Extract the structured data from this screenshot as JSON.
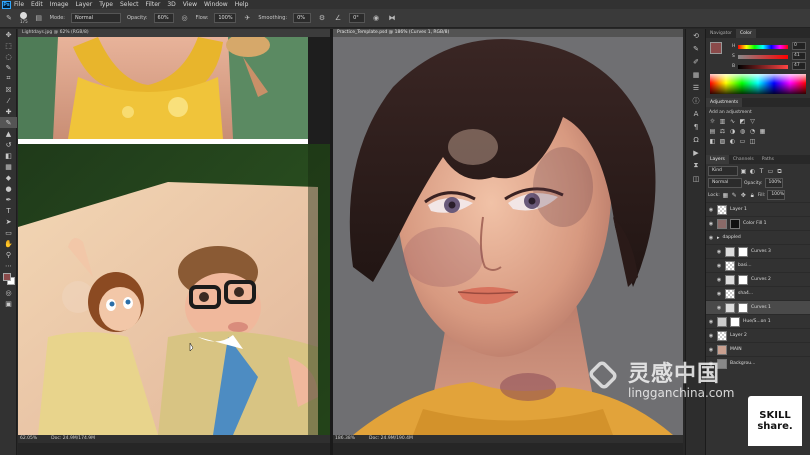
{
  "app": {
    "logo": "Ps"
  },
  "menu": [
    "File",
    "Edit",
    "Image",
    "Layer",
    "Type",
    "Select",
    "Filter",
    "3D",
    "View",
    "Window",
    "Help"
  ],
  "options": {
    "brush_size": "175",
    "mode_label": "Mode:",
    "mode_value": "Normal",
    "opacity_label": "Opacity:",
    "opacity_value": "60%",
    "flow_label": "Flow:",
    "flow_value": "100%",
    "smoothing_label": "Smoothing:",
    "smoothing_value": "0%",
    "angle_value": "0°"
  },
  "doc1": {
    "tab_title": "Lightdays.jpg @ 62% (RGB/8)",
    "zoom": "62.05%",
    "info": "Doc: 24.9M/174.9M"
  },
  "doc2": {
    "tab_title": "Practice_Template.psd @ 186% (Curves 1, RGB/8)",
    "zoom": "186.38%",
    "info": "Doc: 24.9M/190.4M"
  },
  "color_panel": {
    "tabs": [
      "Navigator",
      "Color"
    ],
    "active_tab": "Color",
    "h": "H",
    "s": "S",
    "b": "B",
    "h_value": "0",
    "s_value": "41",
    "b_value": "47",
    "foreground": "#8a4a4a"
  },
  "adjustments": {
    "title": "Adjustments",
    "hint": "Add an adjustment"
  },
  "layers": {
    "tabs": [
      "Layers",
      "Channels",
      "Paths"
    ],
    "active_tab": "Layers",
    "kind": "Kind",
    "blend": "Normal",
    "opacity_label": "Opacity:",
    "opacity": "100%",
    "lock_label": "Lock:",
    "fill_label": "Fill:",
    "fill": "100%",
    "items": [
      {
        "name": "Layer 1"
      },
      {
        "name": "Color Fill 1"
      },
      {
        "name": "dappled"
      },
      {
        "name": "Curves 3"
      },
      {
        "name": "basi..."
      },
      {
        "name": "Curves 2"
      },
      {
        "name": "sha4..."
      },
      {
        "name": "Curves 1"
      },
      {
        "name": "Hue/S...on 1"
      },
      {
        "name": "Layer 2"
      },
      {
        "name": "MAIN"
      },
      {
        "name": "Backgrou..."
      }
    ]
  },
  "watermark": {
    "site_cn": "灵感中国",
    "site_url": "lingganchina.com",
    "badge": "SKILL share."
  },
  "colors": {
    "accent": "#31a8ff",
    "hue_bar_start": "#ff0000"
  }
}
